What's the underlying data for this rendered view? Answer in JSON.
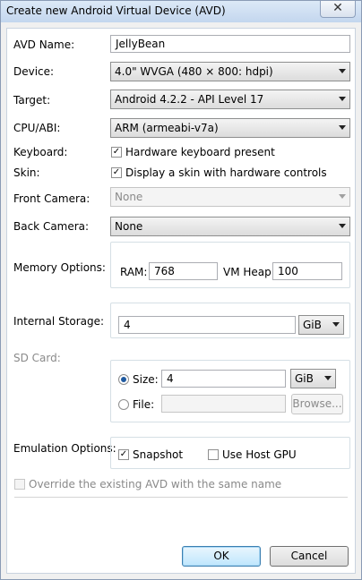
{
  "window": {
    "title": "Create new Android Virtual Device (AVD)",
    "close_glyph": "✕"
  },
  "form": {
    "avd_name": {
      "label": "AVD Name:",
      "value": "JellyBean"
    },
    "device": {
      "label": "Device:",
      "value": "4.0\" WVGA (480 × 800: hdpi)"
    },
    "target": {
      "label": "Target:",
      "value": "Android 4.2.2 - API Level 17"
    },
    "cpu_abi": {
      "label": "CPU/ABI:",
      "value": "ARM (armeabi-v7a)"
    },
    "keyboard": {
      "label": "Keyboard:",
      "checkbox_label": "Hardware keyboard present",
      "checked": true
    },
    "skin": {
      "label": "Skin:",
      "checkbox_label": "Display a skin with hardware controls",
      "checked": true
    },
    "front_camera": {
      "label": "Front Camera:",
      "value": "None"
    },
    "back_camera": {
      "label": "Back Camera:",
      "value": "None"
    },
    "memory": {
      "label": "Memory Options:",
      "ram_label": "RAM:",
      "ram_value": "768",
      "vm_heap_label": "VM Heap:",
      "vm_heap_value": "100"
    },
    "internal_storage": {
      "label": "Internal Storage:",
      "value": "4",
      "unit": "GiB"
    },
    "sd_card": {
      "label": "SD Card:",
      "size_label": "Size:",
      "size_value": "4",
      "size_unit": "GiB",
      "file_label": "File:",
      "file_value": "",
      "browse_label": "Browse..."
    },
    "emulation": {
      "label": "Emulation Options:",
      "snapshot_label": "Snapshot",
      "snapshot_checked": true,
      "host_gpu_label": "Use Host GPU",
      "host_gpu_checked": false
    },
    "override": {
      "label": "Override the existing AVD with the same name",
      "checked": false
    }
  },
  "buttons": {
    "ok": "OK",
    "cancel": "Cancel"
  }
}
